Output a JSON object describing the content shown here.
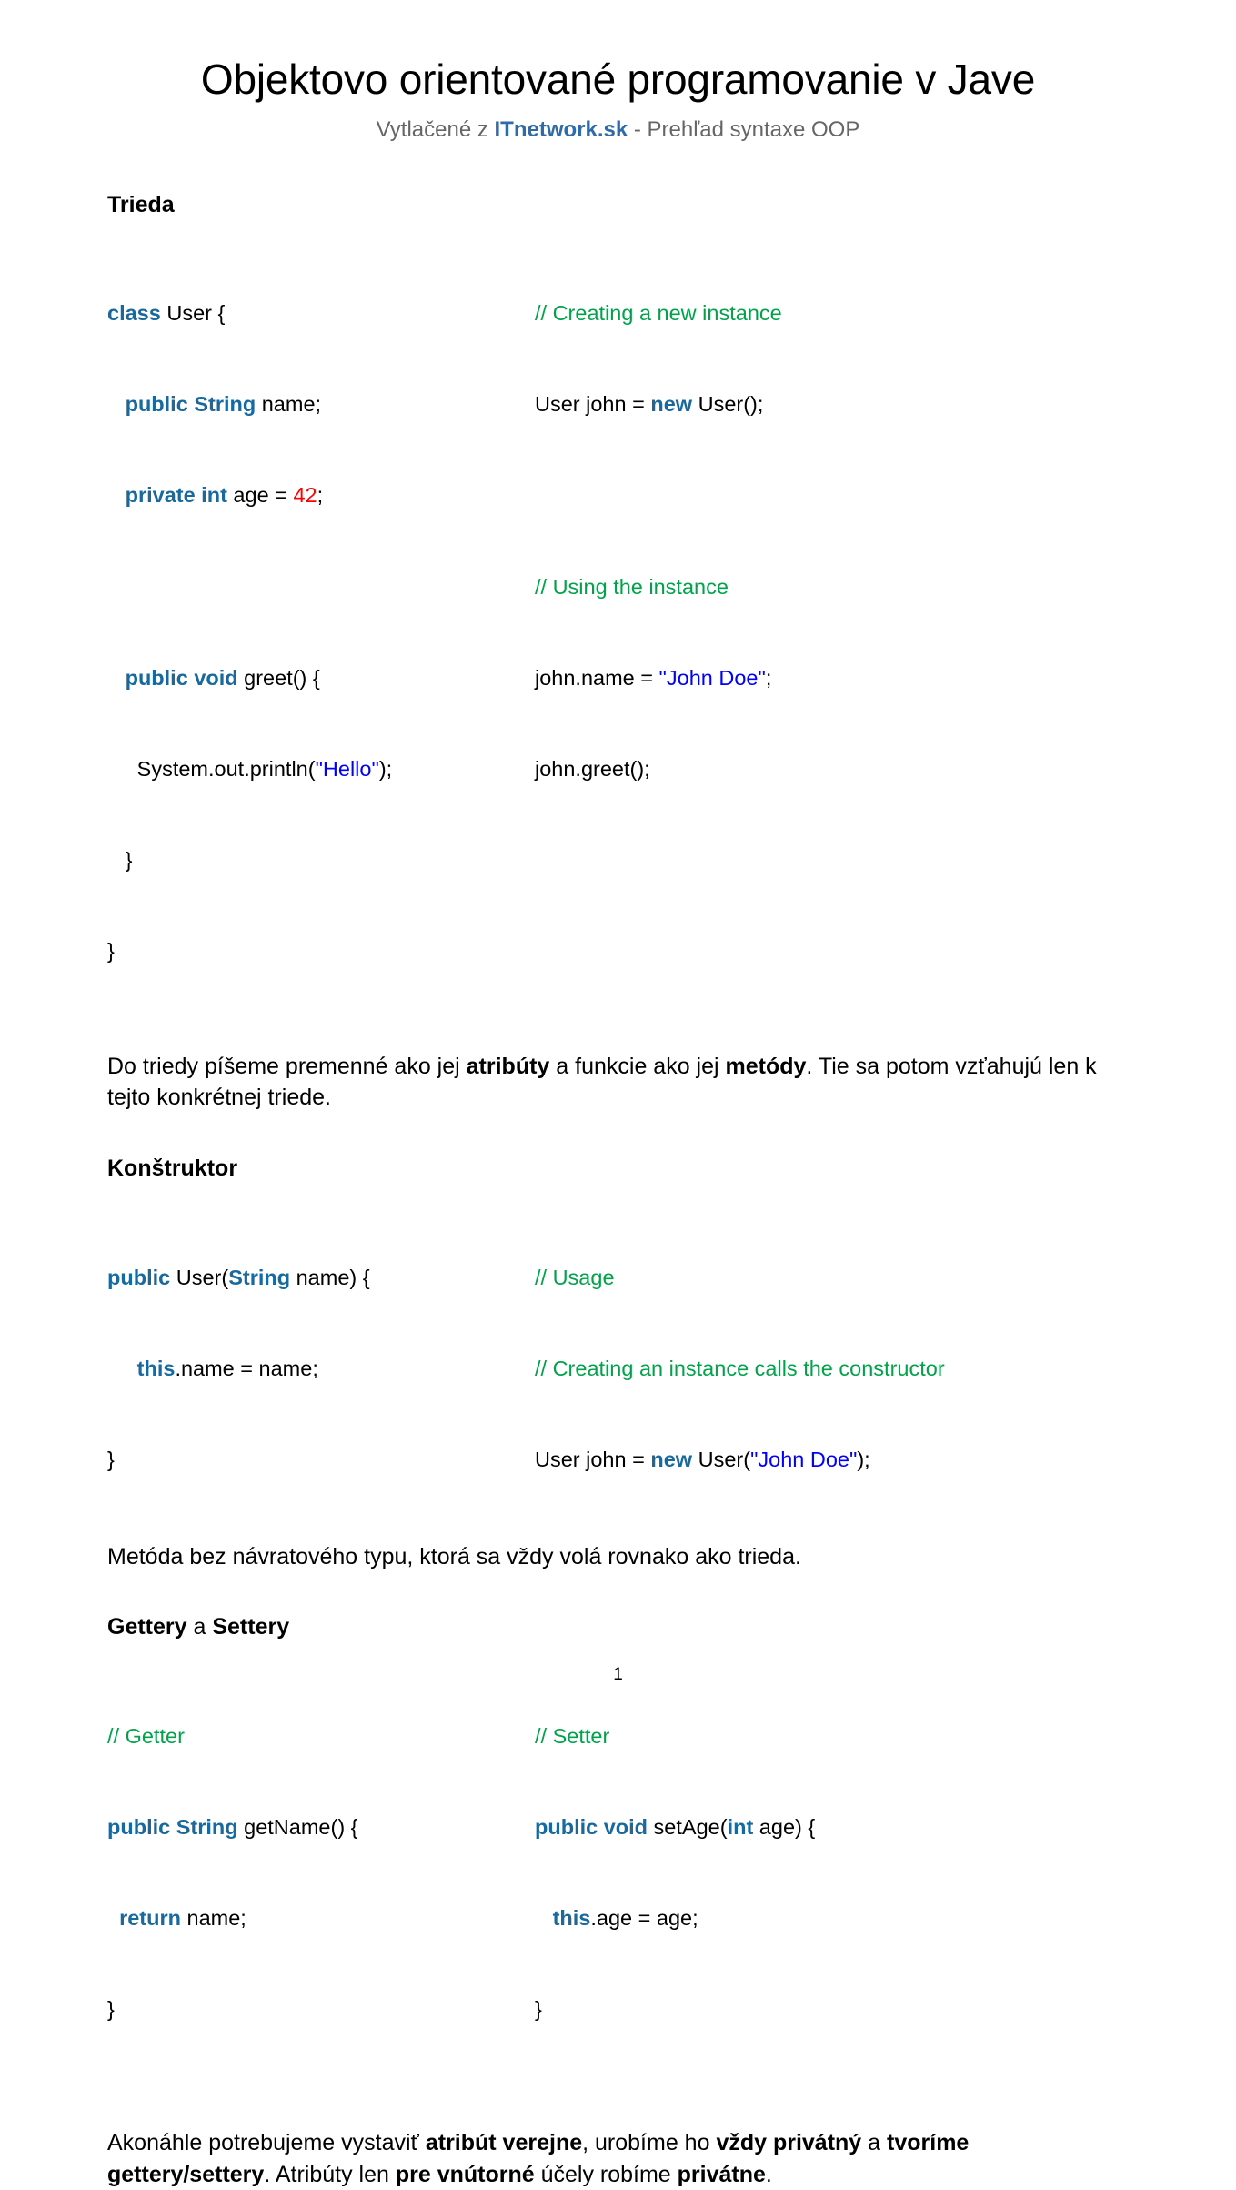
{
  "document": {
    "title": "Objektovo orientované programovanie v Jave",
    "subtitle_prefix": "Vytlačené z ",
    "subtitle_brand": "ITnetwork.sk",
    "subtitle_suffix": " - Prehľad syntaxe OOP",
    "page_number": "1"
  },
  "colors": {
    "keyword": "#17699e",
    "string": "#0000ff",
    "number": "#ff0000",
    "comment": "#00a34a",
    "brand": "#2e6ba8",
    "subtitle": "#666666"
  },
  "sections": {
    "trieda": {
      "heading": "Trieda",
      "code_left": {
        "l1_kw": "class",
        "l1_rest": " User {",
        "l2_kw": "public String",
        "l2_rest": " name;",
        "l3_kw": "private int",
        "l3_mid": " age = ",
        "l3_num": "42",
        "l3_end": ";",
        "l5_kw": "public void",
        "l5_rest": " greet() {",
        "l6_pre": "System.out.println(",
        "l6_str": "\"Hello\"",
        "l6_post": ");",
        "l7": "}",
        "l8": "}"
      },
      "code_right": {
        "c1": "// Creating a new instance",
        "c2_pre": "User john = ",
        "c2_kw": "new",
        "c2_post": " User();",
        "c3": "// Using the instance",
        "c4_pre": "john.name = ",
        "c4_str": "\"John Doe\"",
        "c4_post": ";",
        "c5": "john.greet();"
      },
      "paragraph": {
        "p1": "Do triedy píšeme premenné ako jej ",
        "b1": "atribúty",
        "p2": " a funkcie ako jej ",
        "b2": "metódy",
        "p3": ". Tie sa potom vzťahujú len k tejto konkrétnej triede."
      }
    },
    "konstruktor": {
      "heading": "Konštruktor",
      "code_left": {
        "l1_kw": "public",
        "l1_mid": " User(",
        "l1_kw2": "String",
        "l1_end": " name) {",
        "l2_kw": "this",
        "l2_rest": ".name = name;",
        "l3": "}"
      },
      "code_right": {
        "c1": "// Usage",
        "c2": "// Creating an instance calls the constructor",
        "c3_pre": "User john = ",
        "c3_kw": "new",
        "c3_mid": " User(",
        "c3_str": "\"John Doe\"",
        "c3_post": ");"
      },
      "paragraph": "Metóda bez návratového typu, ktorá sa vždy volá rovnako ako trieda."
    },
    "gettery": {
      "heading_b1": "Gettery",
      "heading_mid": " a ",
      "heading_b2": "Settery",
      "code_left": {
        "c1": "// Getter",
        "l2_kw": "public String",
        "l2_rest": " getName() {",
        "l3_kw": "return",
        "l3_rest": " name;",
        "l4": "}"
      },
      "code_right": {
        "c1": "// Setter",
        "l2_kw": "public void",
        "l2_mid": " setAge(",
        "l2_kw2": "int",
        "l2_end": " age) {",
        "l3_kw": "this",
        "l3_rest": ".age = age;",
        "l4": "}"
      },
      "paragraph": {
        "p1": "Akonáhle potrebujeme vystaviť ",
        "b1": "atribút verejne",
        "p2": ", urobíme ho ",
        "b2": "vždy privátný",
        "p3": " a ",
        "b3": "tvoríme gettery/settery",
        "p4": ". Atribúty len ",
        "b4": "pre vnútorné",
        "p5": " účely robíme ",
        "b5": "privátne",
        "p6": "."
      }
    }
  }
}
